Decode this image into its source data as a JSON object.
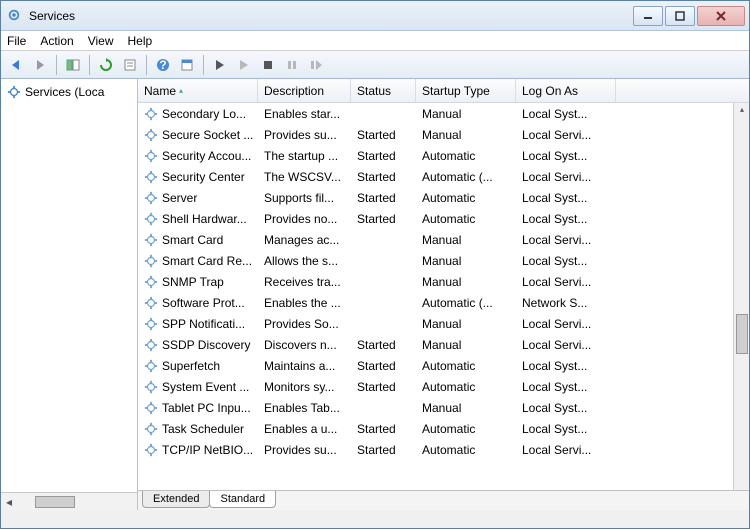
{
  "window": {
    "title": "Services"
  },
  "menu": {
    "file": "File",
    "action": "Action",
    "view": "View",
    "help": "Help"
  },
  "tree": {
    "root": "Services (Loca"
  },
  "columns": {
    "name": "Name",
    "desc": "Description",
    "status": "Status",
    "startup": "Startup Type",
    "logon": "Log On As"
  },
  "tabs": {
    "extended": "Extended",
    "standard": "Standard"
  },
  "rows": [
    {
      "name": "Secondary Lo...",
      "desc": "Enables star...",
      "status": "",
      "startup": "Manual",
      "logon": "Local Syst..."
    },
    {
      "name": "Secure Socket ...",
      "desc": "Provides su...",
      "status": "Started",
      "startup": "Manual",
      "logon": "Local Servi..."
    },
    {
      "name": "Security Accou...",
      "desc": "The startup ...",
      "status": "Started",
      "startup": "Automatic",
      "logon": "Local Syst..."
    },
    {
      "name": "Security Center",
      "desc": "The WSCSV...",
      "status": "Started",
      "startup": "Automatic (...",
      "logon": "Local Servi..."
    },
    {
      "name": "Server",
      "desc": "Supports fil...",
      "status": "Started",
      "startup": "Automatic",
      "logon": "Local Syst..."
    },
    {
      "name": "Shell Hardwar...",
      "desc": "Provides no...",
      "status": "Started",
      "startup": "Automatic",
      "logon": "Local Syst..."
    },
    {
      "name": "Smart Card",
      "desc": "Manages ac...",
      "status": "",
      "startup": "Manual",
      "logon": "Local Servi..."
    },
    {
      "name": "Smart Card Re...",
      "desc": "Allows the s...",
      "status": "",
      "startup": "Manual",
      "logon": "Local Syst..."
    },
    {
      "name": "SNMP Trap",
      "desc": "Receives tra...",
      "status": "",
      "startup": "Manual",
      "logon": "Local Servi..."
    },
    {
      "name": "Software Prot...",
      "desc": "Enables the ...",
      "status": "",
      "startup": "Automatic (...",
      "logon": "Network S..."
    },
    {
      "name": "SPP Notificati...",
      "desc": "Provides So...",
      "status": "",
      "startup": "Manual",
      "logon": "Local Servi..."
    },
    {
      "name": "SSDP Discovery",
      "desc": "Discovers n...",
      "status": "Started",
      "startup": "Manual",
      "logon": "Local Servi..."
    },
    {
      "name": "Superfetch",
      "desc": "Maintains a...",
      "status": "Started",
      "startup": "Automatic",
      "logon": "Local Syst..."
    },
    {
      "name": "System Event ...",
      "desc": "Monitors sy...",
      "status": "Started",
      "startup": "Automatic",
      "logon": "Local Syst..."
    },
    {
      "name": "Tablet PC Inpu...",
      "desc": "Enables Tab...",
      "status": "",
      "startup": "Manual",
      "logon": "Local Syst..."
    },
    {
      "name": "Task Scheduler",
      "desc": "Enables a u...",
      "status": "Started",
      "startup": "Automatic",
      "logon": "Local Syst..."
    },
    {
      "name": "TCP/IP NetBIO...",
      "desc": "Provides su...",
      "status": "Started",
      "startup": "Automatic",
      "logon": "Local Servi..."
    }
  ]
}
